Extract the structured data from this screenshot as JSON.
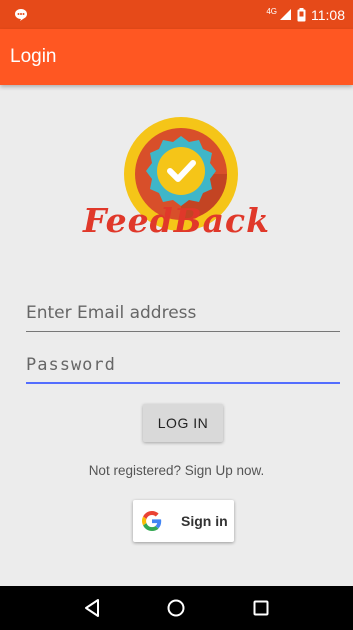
{
  "status_bar": {
    "network": "4G",
    "time": "11:08"
  },
  "app_bar": {
    "title": "Login"
  },
  "brand": {
    "name": "FeedBack"
  },
  "form": {
    "email_placeholder": "Enter Email address",
    "password_placeholder": "Password",
    "login_label": "LOG IN",
    "signup_text": "Not registered? Sign Up now.",
    "google_label": "Sign in"
  },
  "colors": {
    "status_bar": "#e64a19",
    "app_bar": "#ff5722",
    "brand_text": "#e0382a",
    "focus_underline": "#536dfe",
    "logo_ring": "#f5c518",
    "logo_inner": "#d84f2a",
    "logo_badge": "#3fb6c8"
  },
  "icons": {
    "status_left": "chat-bubble-icon",
    "logo": "feedback-check-badge-icon",
    "google": "google-g-icon",
    "nav_back": "back-triangle-icon",
    "nav_home": "home-circle-icon",
    "nav_recent": "recent-apps-square-icon"
  }
}
